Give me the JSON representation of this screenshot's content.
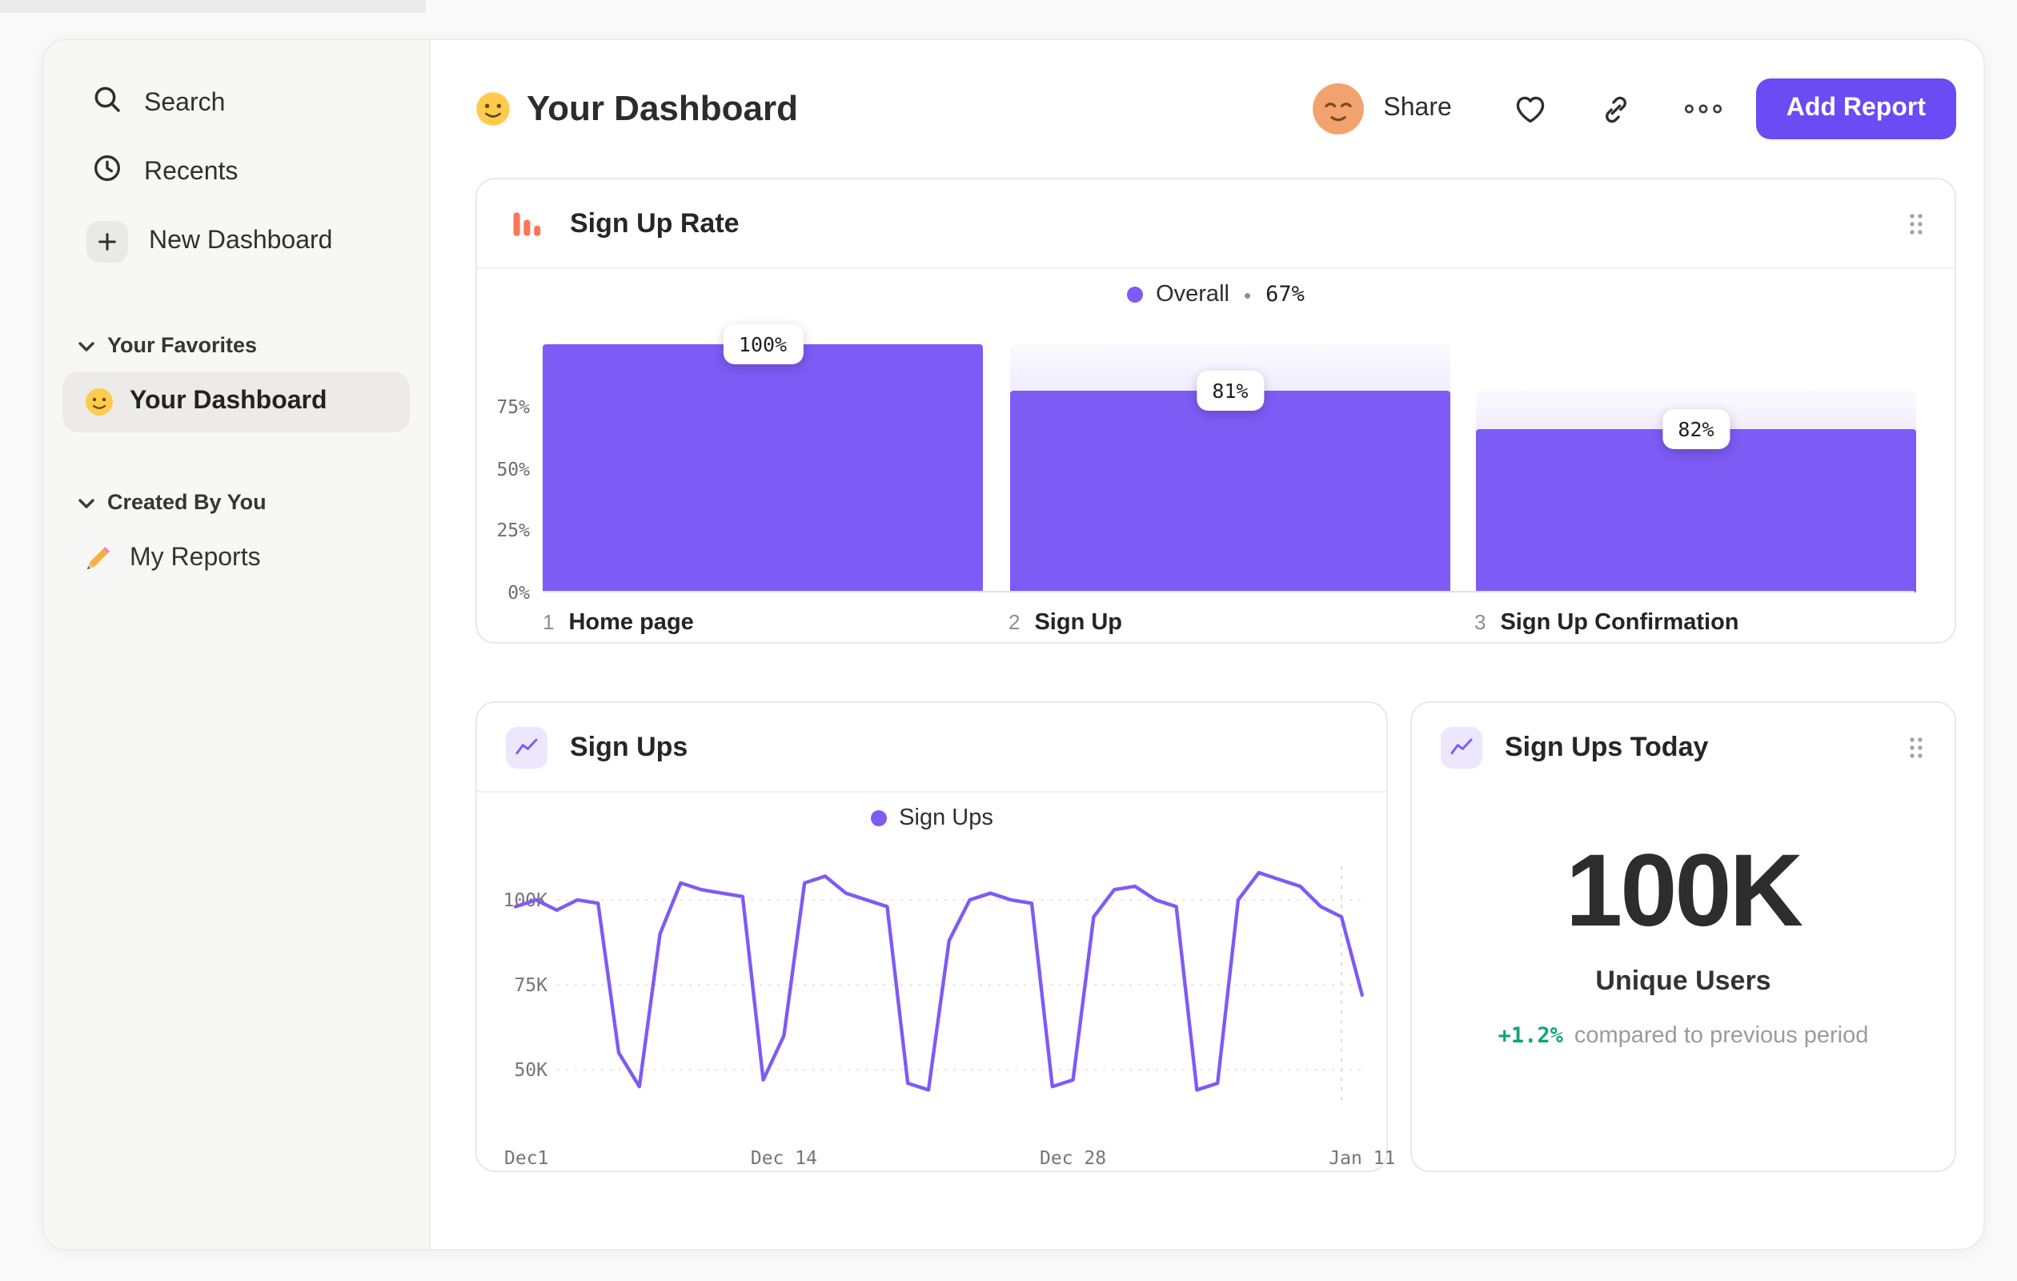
{
  "app": {
    "colors": {
      "accent_purple": "#6A4BF4",
      "chart_purple": "#7D5BF5",
      "icon_orange": "#FF7557",
      "positive_green": "#0CA678",
      "sidebar_bg": "#f7f7f5"
    }
  },
  "sidebar": {
    "search_label": "Search",
    "recents_label": "Recents",
    "new_dashboard_label": "New Dashboard",
    "favorites_section_label": "Your Favorites",
    "favorites_item_label": "Your Dashboard",
    "created_section_label": "Created By You",
    "created_item_label": "My Reports"
  },
  "header": {
    "title": "Your Dashboard",
    "share_label": "Share",
    "add_report_label": "Add Report"
  },
  "funnel_card": {
    "title": "Sign Up Rate",
    "legend_series": "Overall",
    "legend_separator": "•",
    "legend_value": "67%"
  },
  "line_card": {
    "title": "Sign Ups",
    "legend_series": "Sign Ups"
  },
  "stat_card": {
    "title": "Sign Ups Today",
    "value": "100K",
    "metric": "Unique Users",
    "delta": "+1.2%",
    "delta_note": "compared to previous period"
  },
  "chart_data": [
    {
      "type": "bar",
      "subtype": "funnel",
      "title": "Sign Up Rate",
      "overall_conversion_pct": 67,
      "steps": [
        {
          "index": "1",
          "label": "Home page",
          "badge": "100%",
          "step_conversion_pct": 100,
          "bar_pct_of_axis": 100,
          "ghost_pct_of_axis": 100
        },
        {
          "index": "2",
          "label": "Sign Up",
          "badge": "81%",
          "step_conversion_pct": 81,
          "bar_pct_of_axis": 81,
          "ghost_pct_of_axis": 100
        },
        {
          "index": "3",
          "label": "Sign Up Confirmation",
          "badge": "82%",
          "step_conversion_pct": 82,
          "bar_pct_of_axis": 66,
          "ghost_pct_of_axis": 81
        }
      ],
      "y_ticks": [
        {
          "label": "75%",
          "value": 75
        },
        {
          "label": "50%",
          "value": 50
        },
        {
          "label": "25%",
          "value": 25
        },
        {
          "label": "0%",
          "value": 0
        }
      ],
      "ylim": [
        0,
        100
      ],
      "legend_position": "top-center"
    },
    {
      "type": "line",
      "title": "Sign Ups",
      "series": [
        {
          "name": "Sign Ups",
          "unit": "K",
          "values": [
            98,
            100,
            97,
            100,
            99,
            55,
            45,
            90,
            105,
            103,
            102,
            101,
            47,
            60,
            105,
            107,
            102,
            100,
            98,
            46,
            44,
            88,
            100,
            102,
            100,
            99,
            45,
            47,
            95,
            103,
            104,
            100,
            98,
            44,
            46,
            100,
            108,
            106,
            104,
            98,
            95,
            72
          ]
        }
      ],
      "x_ticks": [
        {
          "label": "Dec1",
          "day": 0
        },
        {
          "label": "Dec 14",
          "day": 13
        },
        {
          "label": "Dec 28",
          "day": 27
        },
        {
          "label": "Jan 11",
          "day": 41
        }
      ],
      "y_ticks": [
        {
          "label": "100K",
          "value": 100
        },
        {
          "label": "75K",
          "value": 75
        },
        {
          "label": "50K",
          "value": 50
        }
      ],
      "ylim_k": [
        40,
        112
      ],
      "grid": "dotted-horizontal",
      "legend_position": "top-center"
    },
    {
      "type": "stat",
      "title": "Sign Ups Today",
      "value": "100K",
      "metric": "Unique Users",
      "change": "+1.2%",
      "comparison": "compared to previous period"
    }
  ]
}
